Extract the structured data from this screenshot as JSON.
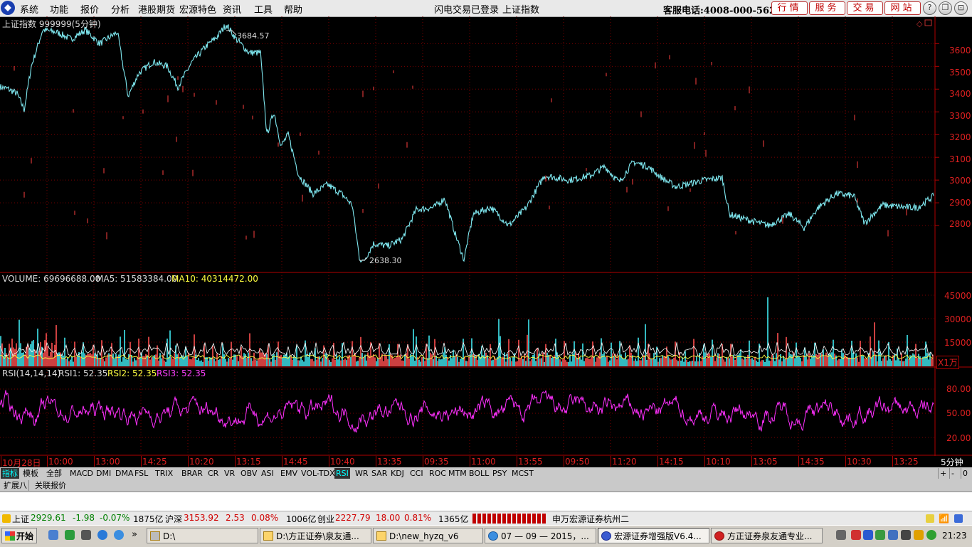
{
  "menu": {
    "items": [
      "系统",
      "功能",
      "报价",
      "分析",
      "港股期货",
      "宏源特色",
      "资讯",
      "工具",
      "帮助"
    ],
    "login_status": "闪电交易已登录",
    "current_index": "上证指数",
    "hotline": "客服电话:4008-000-562",
    "buttons": [
      "行情",
      "服务",
      "交易",
      "网站"
    ],
    "window_controls": [
      "?",
      "❐",
      "⊡",
      "✕"
    ]
  },
  "main_chart": {
    "title": "上证指数 999999(5分钟)",
    "high_label": "3684.57",
    "low_label": "2638.30",
    "y_ticks": [
      "3600",
      "3500",
      "3400",
      "3300",
      "3200",
      "3100",
      "3000",
      "2900",
      "2800"
    ],
    "y_values": [
      3600,
      3500,
      3400,
      3300,
      3200,
      3100,
      3000,
      2900,
      2800
    ]
  },
  "volume_chart": {
    "label_volume": "VOLUME: 69696688.00",
    "label_ma5": "MA5: 51583384.00",
    "label_ma10": "MA10: 40314472.00",
    "y_ticks": [
      "45000",
      "30000",
      "15000"
    ],
    "unit": "X1万"
  },
  "rsi_chart": {
    "label_params": "RSI(14,14,14)",
    "label_rsi1": "RSI1: 52.35",
    "label_rsi2": "RSI2: 52.35",
    "label_rsi3": "RSI3: 52.35",
    "y_ticks": [
      "80.00",
      "50.00",
      "20.00"
    ]
  },
  "time_axis": {
    "labels": [
      "10月28日",
      "10:00",
      "13:00",
      "14:25",
      "10:20",
      "13:15",
      "14:45",
      "10:40",
      "13:35",
      "09:35",
      "11:00",
      "13:55",
      "09:50",
      "11:20",
      "14:15",
      "10:10",
      "13:05",
      "14:35",
      "10:30",
      "13:25"
    ],
    "period": "5分钟"
  },
  "indicator_tabs": [
    "指标",
    "模板",
    "全部",
    "MACD",
    "DMI",
    "DMA",
    "FSL",
    "TRIX",
    "BRAR",
    "CR",
    "VR",
    "OBV",
    "ASI",
    "EMV",
    "VOL-TDX",
    "RSI",
    "WR",
    "SAR",
    "KDJ",
    "CCI",
    "ROC",
    "MTM",
    "BOLL",
    "PSY",
    "MCST"
  ],
  "active_tab": "RSI",
  "zoom_buttons": [
    "+",
    "-",
    "0"
  ],
  "ext_tabs": [
    "扩展八",
    "关联报价"
  ],
  "status": {
    "sh_name": "上证",
    "sh_value": "2929.61",
    "sh_change": "-1.98",
    "sh_pct": "-0.07%",
    "sh_amount": "1875亿",
    "hs_name": "沪深",
    "hs_value": "3153.92",
    "hs_change": "2.53",
    "hs_pct": "0.08%",
    "hs_amount": "1006亿",
    "cy_name": "创业",
    "cy_value": "2227.79",
    "cy_change": "18.00",
    "cy_pct": "0.81%",
    "cy_amount": "1365亿",
    "broker": "申万宏源证券杭州二"
  },
  "taskbar": {
    "start": "开始",
    "tasks": [
      "D:\\",
      "D:\\方正证券\\泉友通...",
      "D:\\new_hyzq_v6",
      "07 — 09 — 2015，...",
      "宏源证券增强版V6.4...",
      "方正证券泉友通专业..."
    ],
    "clock": "21:23"
  },
  "chart_data": {
    "type": "line",
    "description_series": "上证指数 5分钟",
    "y_range": [
      2600,
      3720
    ],
    "extremes": {
      "high": 3684.57,
      "low": 2638.3
    },
    "path_points": [
      [
        0,
        3410
      ],
      [
        12,
        3400
      ],
      [
        24,
        3380
      ],
      [
        34,
        3310
      ],
      [
        44,
        3500
      ],
      [
        60,
        3660
      ],
      [
        80,
        3650
      ],
      [
        100,
        3620
      ],
      [
        120,
        3660
      ],
      [
        140,
        3600
      ],
      [
        165,
        3650
      ],
      [
        180,
        3370
      ],
      [
        195,
        3470
      ],
      [
        215,
        3520
      ],
      [
        235,
        3500
      ],
      [
        250,
        3410
      ],
      [
        270,
        3520
      ],
      [
        290,
        3590
      ],
      [
        305,
        3630
      ],
      [
        318,
        3684.57
      ],
      [
        332,
        3620
      ],
      [
        350,
        3560
      ],
      [
        366,
        3560
      ],
      [
        375,
        3200
      ],
      [
        385,
        3300
      ],
      [
        395,
        3150
      ],
      [
        405,
        3200
      ],
      [
        420,
        3020
      ],
      [
        440,
        2940
      ],
      [
        460,
        2980
      ],
      [
        480,
        2940
      ],
      [
        495,
        2890
      ],
      [
        505,
        2660
      ],
      [
        510,
        2638.3
      ],
      [
        525,
        2720
      ],
      [
        545,
        2710
      ],
      [
        565,
        2740
      ],
      [
        585,
        2870
      ],
      [
        610,
        2880
      ],
      [
        625,
        2920
      ],
      [
        640,
        2760
      ],
      [
        652,
        2650
      ],
      [
        665,
        2850
      ],
      [
        690,
        2880
      ],
      [
        715,
        2800
      ],
      [
        740,
        2880
      ],
      [
        765,
        3020
      ],
      [
        800,
        3000
      ],
      [
        830,
        3020
      ],
      [
        850,
        3060
      ],
      [
        870,
        2990
      ],
      [
        890,
        3080
      ],
      [
        910,
        3060
      ],
      [
        930,
        3010
      ],
      [
        950,
        2970
      ],
      [
        990,
        3000
      ],
      [
        1015,
        3010
      ],
      [
        1025,
        2850
      ],
      [
        1045,
        2830
      ],
      [
        1080,
        2800
      ],
      [
        1110,
        2850
      ],
      [
        1130,
        2790
      ],
      [
        1150,
        2880
      ],
      [
        1175,
        2940
      ],
      [
        1200,
        2930
      ],
      [
        1215,
        2810
      ],
      [
        1240,
        2890
      ],
      [
        1275,
        2880
      ],
      [
        1290,
        2880
      ],
      [
        1312,
        2930
      ]
    ]
  }
}
